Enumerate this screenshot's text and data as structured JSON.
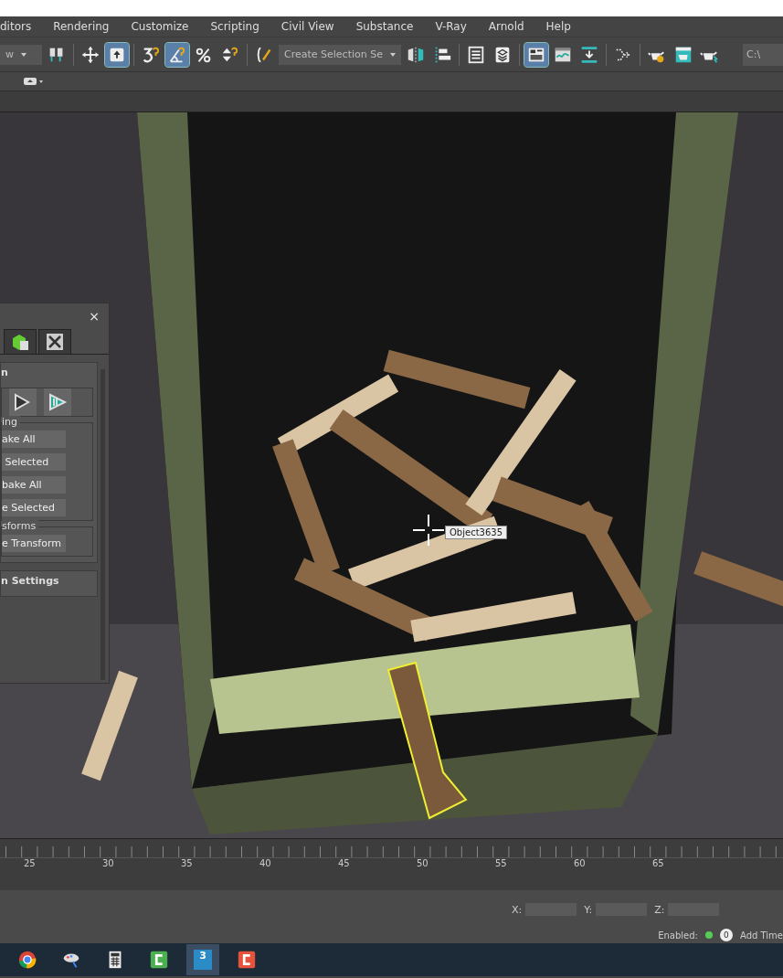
{
  "menu": [
    {
      "label": "ditors"
    },
    {
      "label": "Rendering"
    },
    {
      "label": "Customize"
    },
    {
      "label": "Scripting"
    },
    {
      "label": "Civil View"
    },
    {
      "label": "Substance"
    },
    {
      "label": "V-Ray"
    },
    {
      "label": "Arnold"
    },
    {
      "label": "Help"
    }
  ],
  "toolbar": {
    "left_dropdown": "w",
    "selection_set": "Create Selection Se",
    "path_field": "C:\\",
    "tools": [
      {
        "kind": "link",
        "selected": false
      },
      {
        "kind": "sep"
      },
      {
        "kind": "move",
        "selected": false
      },
      {
        "kind": "select",
        "selected": true
      },
      {
        "kind": "sep"
      },
      {
        "kind": "snap",
        "selected": false
      },
      {
        "kind": "angle",
        "selected": true
      },
      {
        "kind": "percent",
        "selected": false
      },
      {
        "kind": "spinner",
        "selected": false
      },
      {
        "kind": "sep"
      },
      {
        "kind": "braces",
        "selected": false
      },
      {
        "kind": "set"
      },
      {
        "kind": "mirror",
        "selected": false
      },
      {
        "kind": "align",
        "selected": false
      },
      {
        "kind": "sep"
      },
      {
        "kind": "list",
        "selected": false
      },
      {
        "kind": "layers",
        "selected": false
      },
      {
        "kind": "sep"
      },
      {
        "kind": "ribbon",
        "selected": true
      },
      {
        "kind": "curve",
        "selected": false
      },
      {
        "kind": "dope",
        "selected": false
      },
      {
        "kind": "sep"
      },
      {
        "kind": "schematic",
        "selected": false
      },
      {
        "kind": "sep"
      },
      {
        "kind": "teapot",
        "selected": false
      },
      {
        "kind": "frame",
        "selected": false
      },
      {
        "kind": "render",
        "selected": false
      }
    ]
  },
  "viewport": {
    "kind": "picture",
    "tooltip": "Object3635"
  },
  "panel": {
    "close": "×",
    "tabs": [
      {
        "kind": "display",
        "selected": false
      },
      {
        "kind": "utilities",
        "selected": false
      }
    ],
    "rollouts": [
      {
        "title": "n",
        "groups": [
          {
            "kind": "icons"
          },
          {
            "kind": "buttons",
            "label": "ing",
            "buttons": [
              "ake All",
              " Selected",
              "bake All",
              "e Selected"
            ]
          },
          {
            "kind": "buttons",
            "label": "sforms",
            "buttons": [
              "e Transform"
            ]
          }
        ]
      },
      {
        "title": "n Settings"
      }
    ]
  },
  "timeline": {
    "ticks": [
      "25",
      "30",
      "35",
      "40",
      "45",
      "50",
      "55",
      "60",
      "65"
    ]
  },
  "status": {
    "x_label": "X:",
    "y_label": "Y:",
    "z_label": "Z:",
    "enabled_label": "Enabled:",
    "enabled_count": "0",
    "add_time": "Add Time"
  },
  "taskbar": [
    {
      "kind": "browser",
      "selected": false
    },
    {
      "kind": "paint",
      "selected": false
    },
    {
      "kind": "calculator",
      "selected": false
    },
    {
      "kind": "recorder-green",
      "selected": false
    },
    {
      "kind": "max",
      "label": "3",
      "selected": true
    },
    {
      "kind": "recorder-red",
      "selected": false
    }
  ]
}
